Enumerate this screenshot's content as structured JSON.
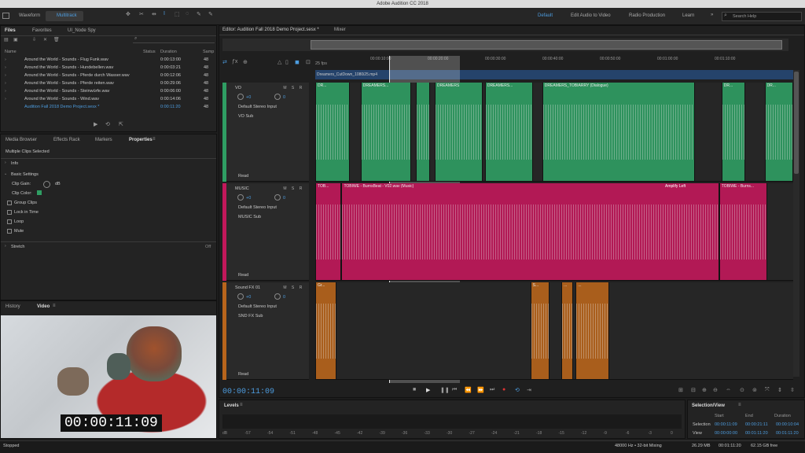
{
  "app_title": "Adobe Audition CC 2018",
  "topbar": {
    "waveform": "Waveform",
    "multitrack": "Multitrack",
    "workspaces": [
      "Default",
      "Edit Audio to Video",
      "Radio Production",
      "Learn"
    ],
    "more": "»",
    "search_placeholder": "Search Help"
  },
  "files_panel": {
    "tabs": [
      "Files",
      "Favorites",
      "UI_Node Spy"
    ],
    "columns": [
      "Name",
      "Status",
      "Duration",
      "Samp"
    ],
    "files": [
      {
        "name": "Around the World - Sounds - Flug Funk.wav",
        "duration": "0:00:13:00",
        "samp": "48"
      },
      {
        "name": "Around the World - Sounds - Hundebellen.wav",
        "duration": "0:00:03:21",
        "samp": "48"
      },
      {
        "name": "Around the World - Sounds - Pferde durch Wasser.wav",
        "duration": "0:00:12:06",
        "samp": "48"
      },
      {
        "name": "Around the World - Sounds - Pferde reiten.wav",
        "duration": "0:00:29:06",
        "samp": "48"
      },
      {
        "name": "Around the World - Sounds - Steinwürfe.wav",
        "duration": "0:00:06:00",
        "samp": "48"
      },
      {
        "name": "Around the World - Sounds - Wind.wav",
        "duration": "0:00:14:06",
        "samp": "48"
      },
      {
        "name": "Audition Fall 2018 Demo Project.sesx *",
        "duration": "0:00:11:20",
        "samp": "48"
      }
    ]
  },
  "props_panel": {
    "tabs": [
      "Media Browser",
      "Effects Rack",
      "Markers",
      "Properties"
    ],
    "subtitle": "Multiple Clips Selected",
    "info": "Info",
    "basic": "Basic Settings",
    "clip_gain": "Clip Gain:",
    "clip_gain_unit": "dB",
    "clip_color": "Clip Color:",
    "checks": [
      "Group Clips",
      "Lock in Time",
      "Loop",
      "Mute"
    ],
    "stretch": "Stretch",
    "stretch_value": "Off"
  },
  "video_panel": {
    "tabs": [
      "History",
      "Video"
    ],
    "timecode": "00:00:11:09"
  },
  "editor": {
    "tab": "Editor: Audition Fall 2018 Demo Project.sesx *",
    "mixer": "Mixer",
    "fps": "25 fps",
    "ruler": [
      "00:00:10:00",
      "00:00:20:00",
      "00:00:30:00",
      "00:00:40:00",
      "00:00:50:00",
      "00:01:00:00",
      "00:01:10:00"
    ],
    "video_track_label": "Dreamers_CutDown_1080i25.mp4",
    "timecode": "00:00:11:09"
  },
  "tracks": [
    {
      "name": "VO",
      "vol": "+0",
      "pan": "0",
      "input": "Default Stereo Input",
      "output": "VO Sub",
      "mode": "Read",
      "color": "#2f9e63",
      "clips": [
        {
          "label": "DR...",
          "x": 0.0,
          "w": 0.072
        },
        {
          "label": "DREAMERS...",
          "x": 0.095,
          "w": 0.105
        },
        {
          "label": "",
          "x": 0.21,
          "w": 0.03
        },
        {
          "label": "DREAMERS",
          "x": 0.25,
          "w": 0.1
        },
        {
          "label": "DREAMERS...",
          "x": 0.355,
          "w": 0.1
        },
        {
          "label": "DREAMERS_TOBIARRY (Dialogue)",
          "x": 0.475,
          "w": 0.32
        },
        {
          "label": "DR...",
          "x": 0.85,
          "w": 0.05
        },
        {
          "label": "DR...",
          "x": 0.94,
          "w": 0.06
        }
      ]
    },
    {
      "name": "MUSIC",
      "vol": "+0",
      "pan": "0",
      "input": "Default Stereo Input",
      "output": "MUSIC Sub",
      "mode": "Read",
      "color": "#c2185b",
      "clips": [
        {
          "label": "TOB...",
          "x": 0.0,
          "w": 0.055
        },
        {
          "label": "TOBIWE - BurnsBeat - V02.wav (Music)",
          "x": 0.055,
          "w": 0.79
        },
        {
          "label": "TOBIWE - Burns...",
          "x": 0.845,
          "w": 0.1
        }
      ],
      "clip_labels_right": "Amplify Left"
    },
    {
      "name": "Sound FX 01",
      "vol": "+0",
      "pan": "0",
      "input": "Default Stereo Input",
      "output": "SND FX Sub",
      "mode": "Read",
      "color": "#b8651c",
      "clips": [
        {
          "label": "Gr...",
          "x": 0.0,
          "w": 0.045
        },
        {
          "label": "S...",
          "x": 0.45,
          "w": 0.04
        },
        {
          "label": "...",
          "x": 0.515,
          "w": 0.025
        },
        {
          "label": "...",
          "x": 0.545,
          "w": 0.07
        }
      ]
    }
  ],
  "levels": {
    "title": "Levels",
    "scale": [
      "dB",
      "-57",
      "-54",
      "-51",
      "-48",
      "-45",
      "-42",
      "-39",
      "-36",
      "-33",
      "-30",
      "-27",
      "-24",
      "-21",
      "-18",
      "-15",
      "-12",
      "-9",
      "-6",
      "-3",
      "0"
    ]
  },
  "selection": {
    "title": "Selection/View",
    "headers": [
      "Start",
      "End",
      "Duration"
    ],
    "rows": [
      {
        "label": "Selection",
        "start": "00:00:11:09",
        "end": "00:00:21:11",
        "duration": "00:00:10:04"
      },
      {
        "label": "View",
        "start": "00:00:00:00",
        "end": "00:01:11:20",
        "duration": "00:01:11:20"
      }
    ]
  },
  "status": {
    "left": "Stopped",
    "format": "48000 Hz • 32-bit Mixing",
    "mb": "26.29 MB",
    "duration": "00:01:11:20",
    "free": "62.15 GB free"
  }
}
